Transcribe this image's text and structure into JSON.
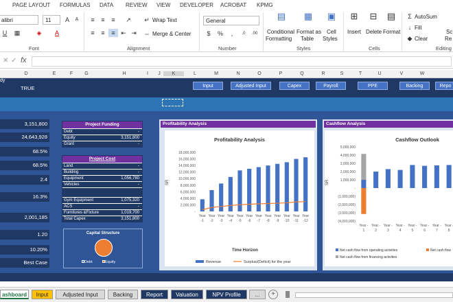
{
  "menu": [
    "PAGE LAYOUT",
    "FORMULAS",
    "DATA",
    "REVIEW",
    "VIEW",
    "DEVELOPER",
    "ACROBAT",
    "KPMG"
  ],
  "ribbon": {
    "font_name": "alibri",
    "font_size": "11",
    "wrap_text": "Wrap Text",
    "merge_center": "Merge & Center",
    "number_format": "General",
    "conditional_formatting": [
      "Conditional",
      "Formatting"
    ],
    "format_as_table": [
      "Format as",
      "Table"
    ],
    "cell_styles": [
      "Cell",
      "Styles"
    ],
    "insert": "Insert",
    "delete": "Delete",
    "format": "Format",
    "autosum": "AutoSum",
    "fill": "Fill",
    "clear": "Clear",
    "sort_partial": "Sc",
    "replace_partial": "Re",
    "groups": {
      "font": "Font",
      "alignment": "Alignment",
      "number": "Number",
      "styles": "Styles",
      "cells": "Cells",
      "editing": "Editing"
    }
  },
  "formula_bar": {
    "fx": "fx",
    "value": ""
  },
  "columns": [
    "D",
    "E",
    "F",
    "G",
    "H",
    "I",
    "J",
    "K",
    "L",
    "M",
    "N",
    "O",
    "P",
    "Q",
    "R",
    "S",
    "T",
    "U",
    "V",
    "W"
  ],
  "dashboard": {
    "row1_label": "dy",
    "row1_value": "TRUE",
    "nav_buttons": [
      "Input",
      "Adjusted Input",
      "Capex",
      "Payroll",
      "PPE",
      "Backing",
      "Repo"
    ],
    "kpis": [
      "3,151,800",
      "24,643,928",
      "68.5%",
      "68.5%",
      "2.4",
      "16.3%",
      "2,001,185",
      "1.20",
      "10.20%",
      "Best Case"
    ],
    "project_funding": {
      "title": "Project Funding",
      "rows": [
        {
          "label": "Debt",
          "value": "-"
        },
        {
          "label": "Equity",
          "value": "3,151,800"
        },
        {
          "label": "Grant",
          "value": "-"
        }
      ]
    },
    "project_cost": {
      "title": "Project Cost",
      "rows": [
        {
          "label": "Land",
          "value": "-"
        },
        {
          "label": "Building",
          "value": "-"
        },
        {
          "label": "Equipment",
          "value": "1,056,780"
        },
        {
          "label": "Vehicles",
          "value": "-"
        },
        {
          "label": "",
          "value": ""
        },
        {
          "label": "Gym Equipment",
          "value": "1,075,320"
        },
        {
          "label": "ACS",
          "value": "-"
        },
        {
          "label": "Furnitures &Fixture",
          "value": "1,019,700"
        },
        {
          "label": "Total Capex",
          "value": "3,151,800"
        }
      ]
    },
    "capital_structure": {
      "title": "Capital Structure",
      "legend": [
        "Debt",
        "Equity"
      ],
      "colors": [
        "#4472c4",
        "#ed7d31"
      ]
    },
    "profitability_header": "Profitability Analysis",
    "cashflow_header": "Cashflow Analysis"
  },
  "chart_data": [
    {
      "type": "bar",
      "title": "Profitability Analysis",
      "xlabel": "Time Horizon",
      "ylabel": "SR",
      "categories": [
        "Year -1",
        "Year -2",
        "Year -3",
        "Year -4",
        "Year -5",
        "Year -6",
        "Year -7",
        "Year -8",
        "Year -9",
        "Year -10",
        "Year -11",
        "Year -12"
      ],
      "series": [
        {
          "name": "Revenue",
          "type": "bar",
          "color": "#4472c4",
          "values": [
            3700000,
            6500000,
            8500000,
            10500000,
            12500000,
            13000000,
            13500000,
            14000000,
            14500000,
            15000000,
            16000000,
            16500000
          ]
        },
        {
          "name": "Surplus/(Deficit) for the year",
          "type": "line",
          "color": "#ed7d31",
          "values": [
            500000,
            1200000,
            1500000,
            1800000,
            2000000,
            2200000,
            2300000,
            2400000,
            2500000,
            2600000,
            2900000,
            3000000
          ]
        }
      ],
      "yticks": [
        "18,000,000",
        "16,000,000",
        "14,000,000",
        "12,000,000",
        "10,000,000",
        "8,000,000",
        "6,000,000",
        "4,000,000",
        "2,000,000",
        "-"
      ],
      "ylim": [
        0,
        18000000
      ],
      "legend": "bottom"
    },
    {
      "type": "bar",
      "title": "Cashflow Outlook",
      "ylabel": "SR",
      "categories": [
        "Year - 1",
        "Year - 2",
        "Year - 3",
        "Year - 4",
        "Year - 5",
        "Year - 6",
        "Year - 7",
        "Year - 8"
      ],
      "x_tick_labels": [
        "Year - 1",
        "Year - 2",
        "Year - 3",
        "Year - 4",
        "Year - 5",
        "Year - 6",
        "Year - 7",
        "Year - 8"
      ],
      "x_tick_row1": [
        "Year -",
        "Year -",
        "Year -",
        "Year -",
        "Year -",
        "Year -",
        "Year -",
        "Year -"
      ],
      "x_tick_row2": [
        "1",
        "2",
        "3",
        "4",
        "5",
        "6",
        "7",
        "8"
      ],
      "series": [
        {
          "name": "Net cash flow from operating activities",
          "color": "#4472c4",
          "values": [
            1000000,
            2000000,
            2300000,
            2200000,
            2800000,
            2700000,
            2750000,
            2800000
          ]
        },
        {
          "name": "Net cash flow from investing activities",
          "color": "#ed7d31",
          "values": [
            -3150000,
            0,
            0,
            0,
            0,
            0,
            0,
            0
          ]
        },
        {
          "name": "Net cash flow from financing activities",
          "color": "#a5a5a5",
          "values": [
            3150000,
            0,
            0,
            0,
            0,
            0,
            0,
            0
          ]
        }
      ],
      "legend_labels": [
        "Net cash flow from operating activities",
        "Net cash flow",
        "Net cash flow from financing activities"
      ],
      "yticks": [
        "5,000,000",
        "4,000,000",
        "3,000,000",
        "2,000,000",
        "1,000,000",
        "-",
        "(1,000,000)",
        "(2,000,000)",
        "(3,000,000)",
        "(4,000,000)"
      ],
      "ylim": [
        -4000000,
        5000000
      ],
      "legend": "bottom"
    }
  ],
  "sheet_tabs": [
    "ashboard",
    "Input",
    "Adjusted Input",
    "Backing",
    "Report",
    "Valuation",
    "NPV Profile",
    "..."
  ],
  "sheet_tab_colors": [
    "#ffc000",
    "#ffc000",
    "#d9d9d9",
    "#d9d9d9",
    "#1f3864",
    "#1f3864",
    "#1f3864",
    "#d9d9d9"
  ]
}
